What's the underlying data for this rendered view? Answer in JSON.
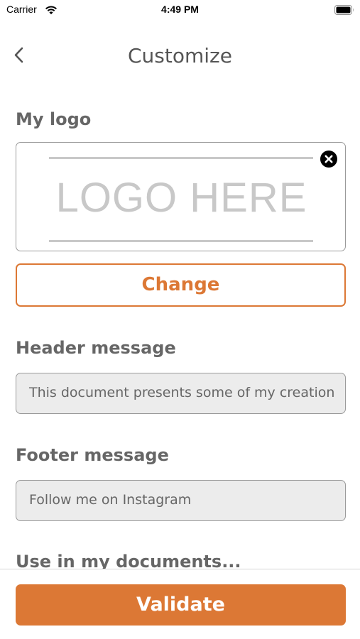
{
  "status_bar": {
    "carrier": "Carrier",
    "time": "4:49 PM",
    "wifi_icon": "wifi-icon",
    "battery_icon": "battery-icon"
  },
  "nav": {
    "title": "Customize",
    "back_icon": "chevron-left-icon"
  },
  "logo_section": {
    "label": "My logo",
    "placeholder_text": "LOGO HERE",
    "remove_icon": "close-circle-icon",
    "change_label": "Change"
  },
  "header_section": {
    "label": "Header message",
    "value": "This document presents some of my creation"
  },
  "footer_section": {
    "label": "Footer message",
    "value": "Follow me on Instagram"
  },
  "documents_section": {
    "label": "Use in my documents..."
  },
  "footer_bar": {
    "validate_label": "Validate"
  },
  "colors": {
    "accent": "#dc7835",
    "label": "#666666",
    "field_background": "#ececec"
  }
}
